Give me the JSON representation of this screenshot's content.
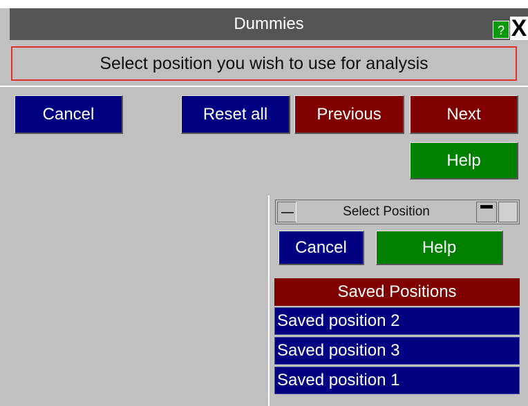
{
  "window": {
    "title": "Dummies",
    "help_glyph": "?",
    "close_glyph": "X",
    "instruction": "Select position you wish to use for analysis"
  },
  "toolbar": {
    "cancel_label": "Cancel",
    "reset_all_label": "Reset all",
    "previous_label": "Previous",
    "next_label": "Next",
    "help_label": "Help"
  },
  "select_position_panel": {
    "title": "Select Position",
    "cancel_label": "Cancel",
    "help_label": "Help",
    "list_header": "Saved Positions",
    "items": [
      "Saved position 2",
      "Saved position 3",
      "Saved position 1"
    ]
  },
  "colors": {
    "title_bar": "#555555",
    "blue_button": "#000080",
    "red_button": "#800000",
    "green_button": "#008000",
    "instruction_border": "#e0302a"
  }
}
